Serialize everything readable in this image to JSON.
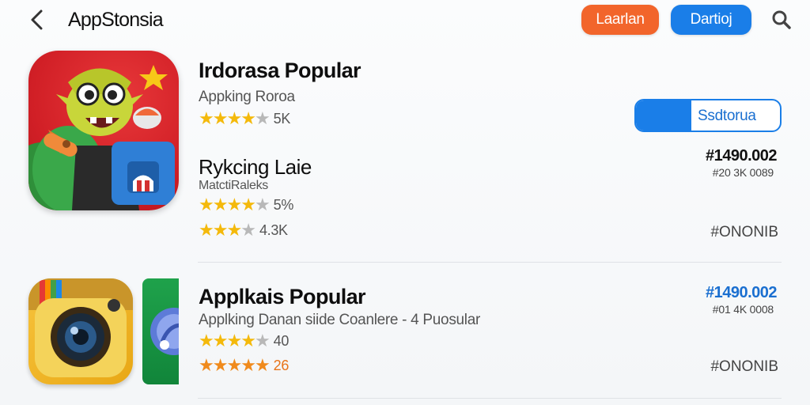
{
  "header": {
    "title": "AppStonsia",
    "btn_orange": "Laarlan",
    "btn_blue": "Dartioj",
    "orange_color": "#f2652b",
    "blue_color": "#1a7ee8"
  },
  "icons": {
    "back": "chevron-left-icon",
    "search": "search-icon"
  },
  "item1": {
    "title": "Irdorasa Popular",
    "subtitle": "Appking Roroa",
    "rating_text": "5K",
    "rating_stars": 4,
    "action_label": "Ssdtorua"
  },
  "item2": {
    "title": "Rykcing Laie",
    "subtitle": "MatctiRaleks",
    "rating1_text": "5%",
    "rating1_stars": 4,
    "rating2_text": "4.3K",
    "rating2_stars": 3,
    "rank_main": "#1490.002",
    "rank_sub": "#20 3K 0089",
    "code": "#ONONIB"
  },
  "item3": {
    "title": "Applkais Popular",
    "subtitle": "Applking Danan siide Coanlere - 4 Puosular",
    "rating1_text": "40",
    "rating1_stars": 4,
    "rating2_text": "26",
    "rating2_stars": 5,
    "rank_main": "#1490.002",
    "rank_sub": "#01 4K 0008",
    "code": "#ONONIB"
  }
}
